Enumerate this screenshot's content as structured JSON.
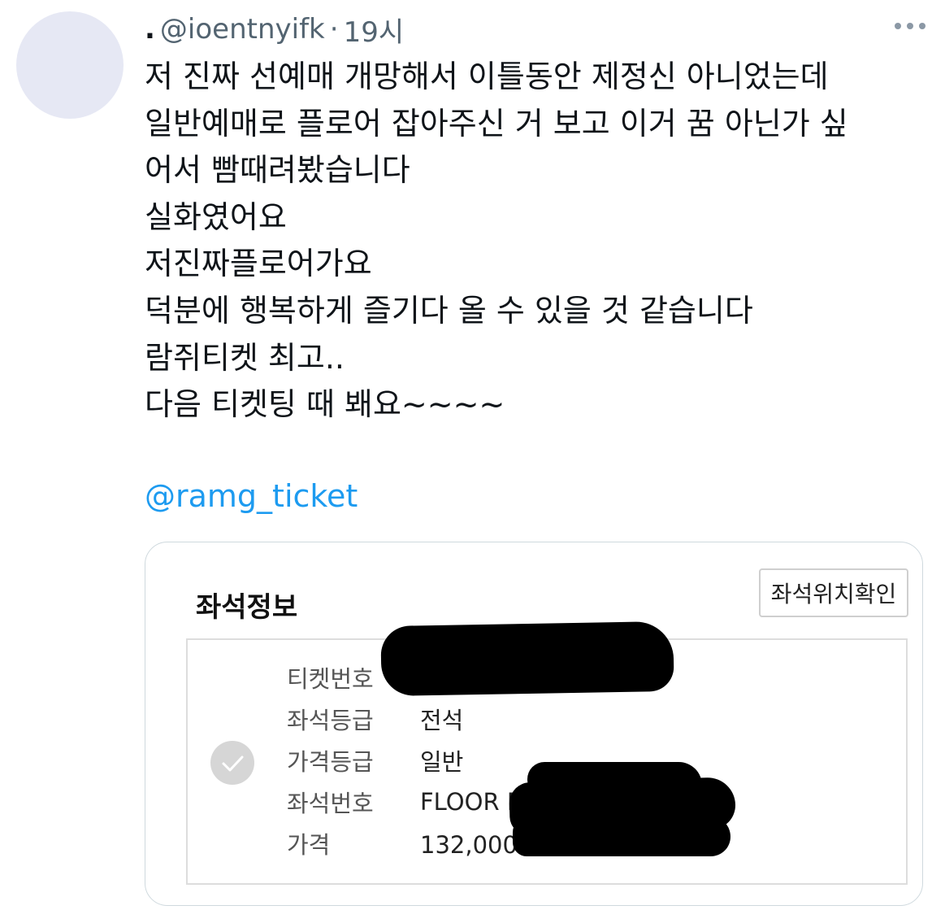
{
  "tweet": {
    "display_name": ".",
    "handle": "@ioentnyifk",
    "separator": "·",
    "time": "19시",
    "text_lines": [
      "저 진짜 선예매 개망해서 이틀동안 제정신 아니었는데",
      "일반예매로 플로어 잡아주신 거 보고 이거 꿈 아닌가 싶",
      "어서 빰때려봤습니다",
      "실화였어요",
      "저진짜플로어가요",
      "덕분에 행복하게 즐기다 올 수 있을 것 같습니다",
      "람쥐티켓 최고..",
      "다음 티켓팅 때 봬요~~~~"
    ],
    "mention": "@ramg_ticket"
  },
  "card": {
    "title": "좌석정보",
    "location_button": "좌석위치확인",
    "rows": [
      {
        "label": "티켓번호",
        "value": ""
      },
      {
        "label": "좌석등급",
        "value": "전석"
      },
      {
        "label": "가격등급",
        "value": "일반"
      },
      {
        "label": "좌석번호",
        "value": "FLOOR B"
      },
      {
        "label": "가격",
        "value": "132,000원"
      }
    ]
  },
  "icons": {
    "more": "more-horizontal-icon",
    "check": "check-icon"
  },
  "colors": {
    "link": "#1d9bf0",
    "secondary_text": "#536471",
    "avatar": "#e6e8f4"
  }
}
